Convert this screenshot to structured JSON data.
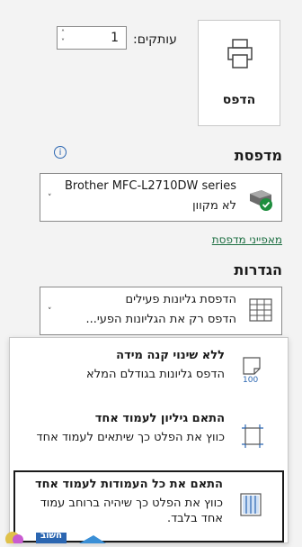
{
  "print": {
    "label": "הדפס",
    "icon": "printer-icon"
  },
  "copies": {
    "label": "עותקים:",
    "value": "1"
  },
  "printer_section": {
    "title": "מדפסת",
    "name": "Brother MFC-L2710DW series",
    "status": "לא מקוון",
    "properties_link": "מאפייני מדפסת"
  },
  "settings_section": {
    "title": "הגדרות",
    "selected_line1": "הדפסת גליונות פעילים",
    "selected_line2": "הדפס רק את הגליונות הפעי..."
  },
  "scaling_menu": {
    "items": [
      {
        "title": "ללא שינוי קנה מידה",
        "desc": "הדפס גליונות בגודלם המלא",
        "icon_text": "100"
      },
      {
        "title": "התאם גיליון לעמוד אחד",
        "desc": "כווץ את הפלט כך שיתאים לעמוד אחד"
      },
      {
        "title": "התאם את כל העמודות לעמוד אחד",
        "desc": "כווץ את הפלט כך שיהיה ברוחב עמוד אחד בלבד."
      }
    ]
  },
  "taskbar": {
    "partial_label": "חשוב"
  },
  "colors": {
    "accent": "#1d6f42",
    "info": "#2b66b1",
    "status_ok": "#1e8e3e"
  }
}
